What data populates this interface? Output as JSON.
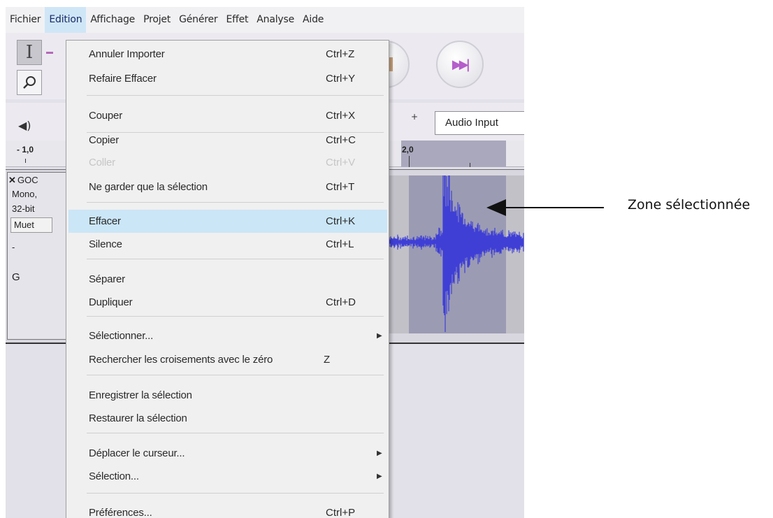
{
  "menubar": {
    "items": [
      "Fichier",
      "Edition",
      "Affichage",
      "Projet",
      "Générer",
      "Effet",
      "Analyse",
      "Aide"
    ],
    "active": "Edition"
  },
  "toolbar": {
    "selection_tool_icon": "I-beam-icon",
    "zoom_tool_icon": "magnifier-icon",
    "speaker_glyph": "◀)",
    "speaker_icon": "speaker-icon",
    "stop_icon": "stop-icon",
    "skip_end_icon": "skip-to-end-icon",
    "plus_label": "+",
    "audio_input": "Audio Input"
  },
  "ruler": {
    "labels": [
      "- 1,0",
      "2,0"
    ]
  },
  "track": {
    "close": "✕",
    "name": "GOC",
    "meta1": "Mono,",
    "meta2": "32-bit",
    "mute": "Muet",
    "gain_slider": "-",
    "pan_slider": "G"
  },
  "edit_menu": {
    "items": [
      {
        "label": "Annuler Importer",
        "shortcut": "Ctrl+Z"
      },
      {
        "label": "Refaire Effacer",
        "shortcut": "Ctrl+Y"
      },
      {
        "label": "Couper",
        "shortcut": "Ctrl+X"
      },
      {
        "label": "Copier",
        "shortcut": "Ctrl+C"
      },
      {
        "label": "Coller",
        "shortcut": "Ctrl+V",
        "disabled": true
      },
      {
        "label": "Ne garder que la sélection",
        "shortcut": "Ctrl+T"
      },
      {
        "label": "Effacer",
        "shortcut": "Ctrl+K",
        "highlighted": true
      },
      {
        "label": "Silence",
        "shortcut": "Ctrl+L"
      },
      {
        "label": "Séparer",
        "shortcut": ""
      },
      {
        "label": "Dupliquer",
        "shortcut": "Ctrl+D"
      },
      {
        "label": "Sélectionner...",
        "shortcut": "",
        "submenu": true
      },
      {
        "label": "Rechercher les croisements avec le zéro",
        "shortcut": "Z"
      },
      {
        "label": "Enregistrer la sélection",
        "shortcut": ""
      },
      {
        "label": "Restaurer la sélection",
        "shortcut": ""
      },
      {
        "label": "Déplacer le curseur...",
        "shortcut": "",
        "submenu": true
      },
      {
        "label": "Sélection...",
        "shortcut": "",
        "submenu": true
      },
      {
        "label": "Préférences...",
        "shortcut": "Ctrl+P"
      }
    ],
    "submenu_arrow": "▶"
  },
  "annotation": {
    "text": "Zone sélectionnée"
  },
  "colors": {
    "highlight": "#cbe6f7",
    "waveform": "#3f3fd6",
    "selection": "#9b9bb4"
  }
}
